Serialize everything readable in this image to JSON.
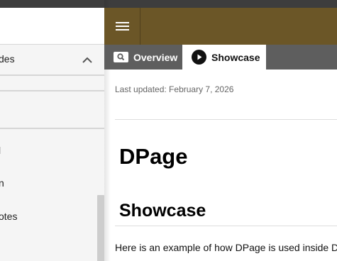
{
  "sidebar": {
    "section_label": "des",
    "items": [
      {
        "label": "l"
      },
      {
        "label": "n"
      },
      {
        "label": "otes"
      }
    ]
  },
  "tabs": [
    {
      "label": "Overview",
      "icon": "search-icon",
      "active": false
    },
    {
      "label": "Showcase",
      "icon": "play-circle-icon",
      "active": true
    }
  ],
  "main": {
    "last_updated": "Last updated: February 7, 2026",
    "title": "DPage",
    "section_heading": "Showcase",
    "intro": "Here is an example of how DPage is used inside DS"
  },
  "colors": {
    "topbar": "#6b5627",
    "tabbar": "#5e5e5e",
    "sidebar": "#f5f5f5"
  }
}
